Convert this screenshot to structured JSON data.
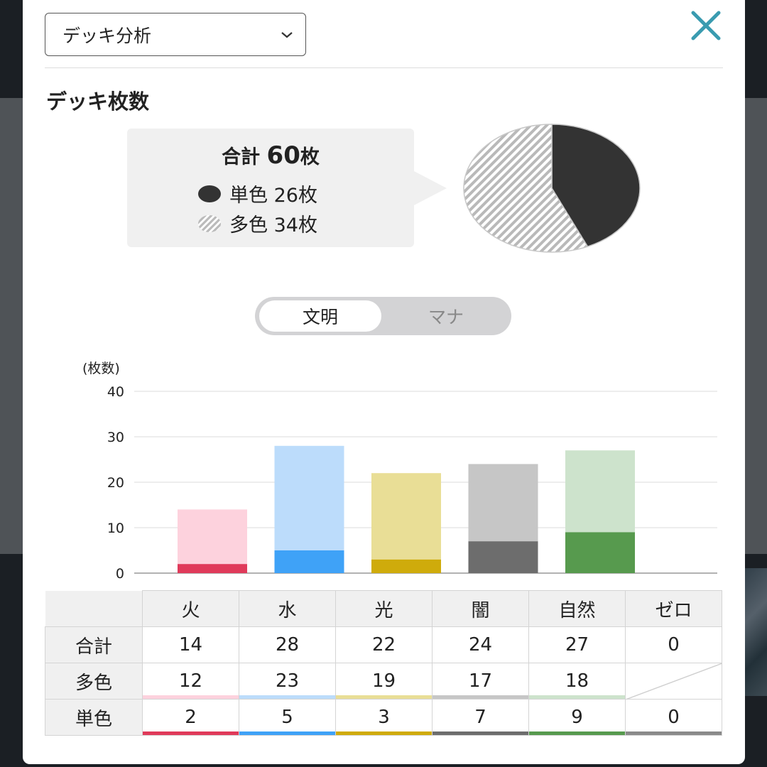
{
  "select": {
    "value": "デッキ分析"
  },
  "section_title": "デッキ枚数",
  "summary": {
    "total_prefix": "合計",
    "total_value": "60",
    "total_suffix": "枚",
    "mono_label": "単色 26枚",
    "multi_label": "多色 34枚"
  },
  "toggle": {
    "active": "文明",
    "inactive": "マナ"
  },
  "colors": {
    "fire": "#e03a5a",
    "fire_light": "#fdd2dd",
    "water": "#3fa2f7",
    "water_light": "#bcdcfb",
    "light": "#cfab0b",
    "light_light": "#e9de96",
    "dark": "#6d6d6d",
    "dark_light": "#c6c6c6",
    "nature": "#579a4e",
    "nature_light": "#cde3cc",
    "zero": "#8a8a8a"
  },
  "chart_data": [
    {
      "type": "pie",
      "categories": [
        "単色",
        "多色"
      ],
      "values": [
        26,
        34
      ]
    },
    {
      "type": "bar",
      "stacked": true,
      "ylabel": "(枚数)",
      "ylim": [
        0,
        40
      ],
      "yticks": [
        0,
        10,
        20,
        30,
        40
      ],
      "categories": [
        "火",
        "水",
        "光",
        "闇",
        "自然",
        "ゼロ"
      ],
      "series": [
        {
          "name": "単色",
          "values": [
            2,
            5,
            3,
            7,
            9,
            0
          ]
        },
        {
          "name": "多色",
          "values": [
            12,
            23,
            19,
            17,
            18,
            0
          ]
        }
      ],
      "grid": true
    }
  ],
  "table": {
    "columns": [
      "火",
      "水",
      "光",
      "闇",
      "自然",
      "ゼロ"
    ],
    "rows": [
      {
        "label": "合計",
        "values": [
          "14",
          "28",
          "22",
          "24",
          "27",
          "0"
        ]
      },
      {
        "label": "多色",
        "values": [
          "12",
          "23",
          "19",
          "17",
          "18",
          ""
        ]
      },
      {
        "label": "単色",
        "values": [
          "2",
          "5",
          "3",
          "7",
          "9",
          "0"
        ]
      }
    ]
  }
}
